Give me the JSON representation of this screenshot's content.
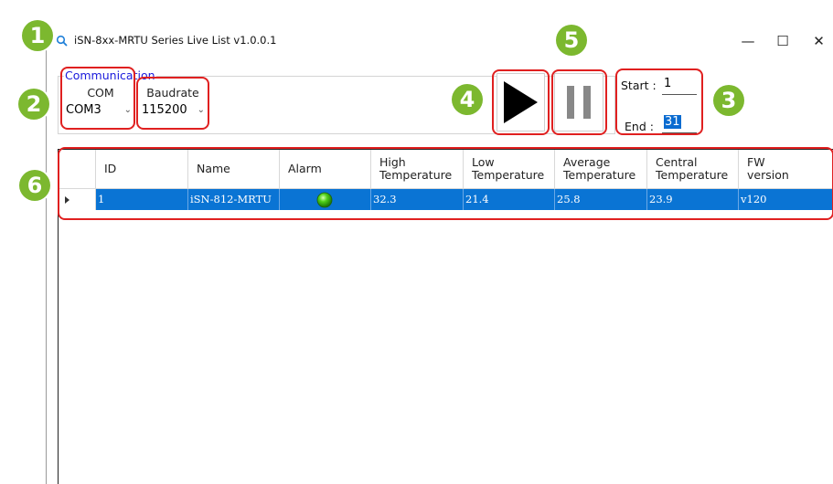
{
  "window": {
    "title": "iSN-8xx-MRTU Series Live List v1.0.0.1",
    "icon": "search-icon",
    "minimize_glyph": "—",
    "maximize_glyph": "☐",
    "close_glyph": "✕"
  },
  "communication": {
    "legend": "Communication",
    "com_label": "COM",
    "com_value": "COM3",
    "baud_label": "Baudrate",
    "baud_value": "115200"
  },
  "controls": {
    "play_icon": "play-icon",
    "pause_icon": "pause-icon"
  },
  "range": {
    "start_label": "Start :",
    "start_value": "1",
    "end_label": "End :",
    "end_value": "31"
  },
  "grid": {
    "columns": [
      {
        "line1": "ID",
        "line2": ""
      },
      {
        "line1": "Name",
        "line2": ""
      },
      {
        "line1": "Alarm",
        "line2": ""
      },
      {
        "line1": "High",
        "line2": "Temperature"
      },
      {
        "line1": "Low",
        "line2": "Temperature"
      },
      {
        "line1": "Average",
        "line2": "Temperature"
      },
      {
        "line1": "Central",
        "line2": "Temperature"
      },
      {
        "line1": "FW",
        "line2": "version"
      }
    ],
    "rows": [
      {
        "id": "1",
        "name": "iSN-812-MRTU",
        "alarm": "green-led-icon",
        "high": "32.3",
        "low": "21.4",
        "average": "25.8",
        "central": "23.9",
        "fw": "v120"
      }
    ]
  },
  "annotations": {
    "badges": [
      "1",
      "2",
      "3",
      "4",
      "5",
      "6"
    ],
    "badge_color": "#7cb82f",
    "highlight_color": "#e02020",
    "selection_color": "#0a74d4"
  }
}
